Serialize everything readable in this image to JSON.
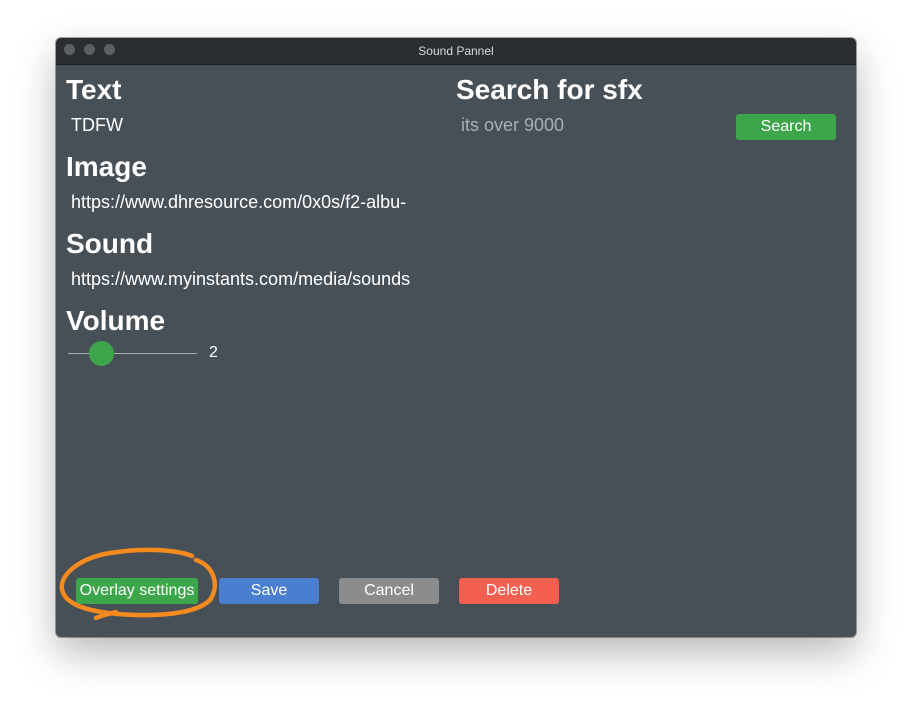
{
  "window": {
    "title": "Sound Pannel"
  },
  "text_section": {
    "heading": "Text",
    "value": "TDFW"
  },
  "image_section": {
    "heading": "Image",
    "value": "https://www.dhresource.com/0x0s/f2-albu-"
  },
  "sound_section": {
    "heading": "Sound",
    "value": "https://www.myinstants.com/media/sounds"
  },
  "volume_section": {
    "heading": "Volume",
    "value": "2",
    "level_fraction": 0.26
  },
  "search_section": {
    "heading": "Search for sfx",
    "placeholder": "its over 9000",
    "button_label": "Search"
  },
  "actions": {
    "overlay_settings_label": "Overlay settings",
    "save_label": "Save",
    "cancel_label": "Cancel",
    "delete_label": "Delete"
  },
  "colors": {
    "window_bg": "#485057",
    "titlebar_bg": "#2a2e32",
    "green": "#3ea64a",
    "blue": "#4a7fcf",
    "gray": "#8a8c8e",
    "red": "#f4604f",
    "annotation_orange": "#f58a1f"
  },
  "icons": {
    "close": "traffic-light-close-icon",
    "minimize": "traffic-light-minimize-icon",
    "zoom": "traffic-light-zoom-icon"
  }
}
